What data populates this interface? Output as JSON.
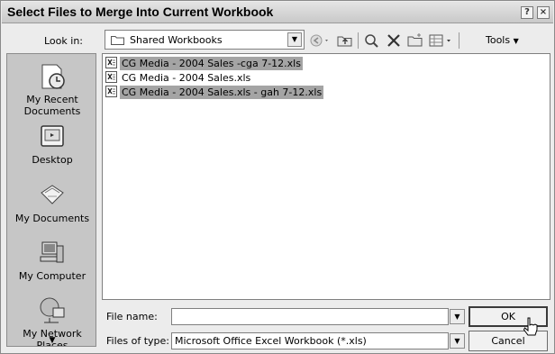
{
  "title": "Select Files to Merge Into Current Workbook",
  "titlebar_buttons": {
    "help": "?",
    "close": "×"
  },
  "look_in": {
    "label": "Look in:",
    "value": "Shared Workbooks",
    "icon": "folder-icon"
  },
  "toolbar": {
    "back_icon": "back-icon",
    "up_icon": "up-folder-icon",
    "search_icon": "search-web-icon",
    "delete_icon": "delete-icon",
    "new_folder_icon": "new-folder-icon",
    "views_icon": "views-icon",
    "tools_label": "Tools"
  },
  "places": [
    {
      "label": "My Recent Documents",
      "icon": "recent-documents-icon"
    },
    {
      "label": "Desktop",
      "icon": "desktop-icon"
    },
    {
      "label": "My Documents",
      "icon": "my-documents-icon"
    },
    {
      "label": "My Computer",
      "icon": "my-computer-icon"
    },
    {
      "label": "My Network Places",
      "icon": "my-network-icon"
    }
  ],
  "files": [
    {
      "name": "CG Media - 2004 Sales -cga 7-12.xls",
      "selected": true
    },
    {
      "name": "CG Media - 2004 Sales.xls",
      "selected": false
    },
    {
      "name": "CG Media - 2004 Sales.xls - gah 7-12.xls",
      "selected": true
    }
  ],
  "file_name": {
    "label": "File name:",
    "value": ""
  },
  "file_type": {
    "label": "Files of type:",
    "value": "Microsoft Office Excel Workbook (*.xls)"
  },
  "buttons": {
    "ok": "OK",
    "cancel": "Cancel"
  },
  "colors": {
    "selection": "#a4a4a4",
    "dialog_bg": "#ececec",
    "places_bg": "#c6c6c6"
  }
}
